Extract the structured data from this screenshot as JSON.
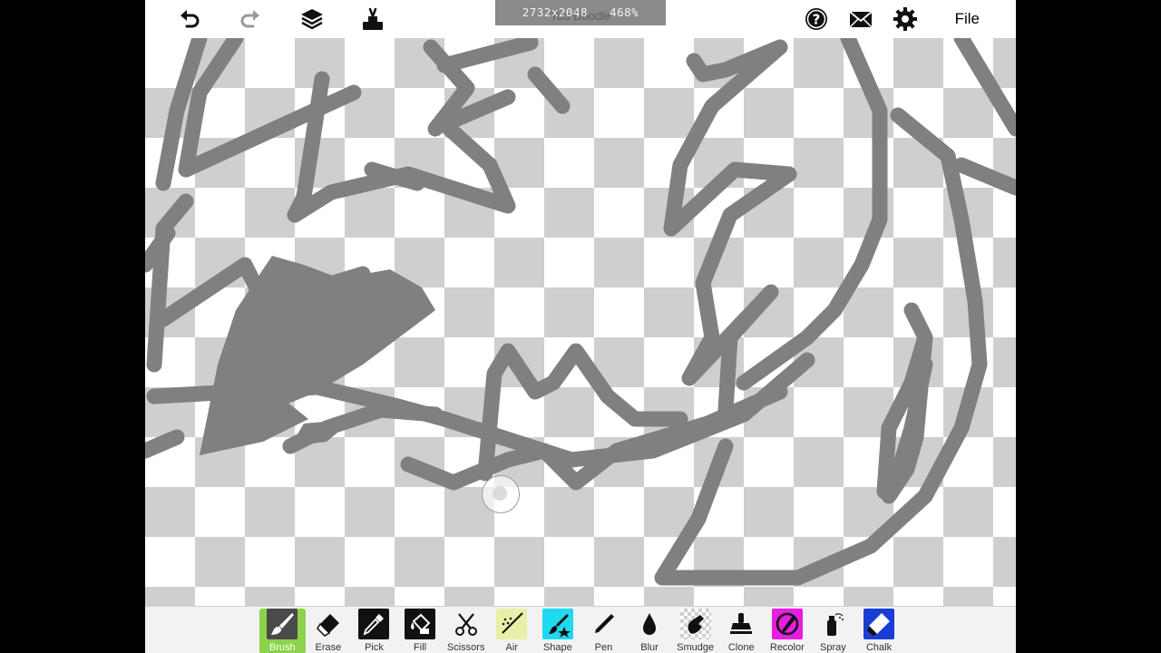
{
  "header": {
    "canvas_size": "2732x2048",
    "zoom": "468%",
    "ghost_title": "You Doodle",
    "file_label": "File"
  },
  "toolbar_icons": [
    "undo-icon",
    "redo-icon",
    "layers-icon",
    "brush-tools-icon",
    "help-icon",
    "mail-icon",
    "gear-icon"
  ],
  "tools": [
    {
      "label": "Brush",
      "icon": "brush-icon",
      "active": true
    },
    {
      "label": "Erase",
      "icon": "eraser-icon"
    },
    {
      "label": "Pick",
      "icon": "eyedropper-icon"
    },
    {
      "label": "Fill",
      "icon": "paint-bucket-icon"
    },
    {
      "label": "Scissors",
      "icon": "scissors-icon"
    },
    {
      "label": "Air",
      "icon": "airbrush-icon",
      "bg": "#e8f0a8"
    },
    {
      "label": "Shape",
      "icon": "shape-icon",
      "bg": "#1fd9f0"
    },
    {
      "label": "Pen",
      "icon": "pen-icon"
    },
    {
      "label": "Blur",
      "icon": "blur-drop-icon"
    },
    {
      "label": "Smudge",
      "icon": "smudge-icon"
    },
    {
      "label": "Clone",
      "icon": "clone-stamp-icon"
    },
    {
      "label": "Recolor",
      "icon": "recolor-icon",
      "bg": "#e51ee0"
    },
    {
      "label": "Spray",
      "icon": "spray-can-icon"
    },
    {
      "label": "Chalk",
      "icon": "chalk-icon",
      "bg": "#1a3dd6"
    }
  ],
  "colors": {
    "active_tool": "#8bd34a",
    "stroke": "#808080"
  }
}
